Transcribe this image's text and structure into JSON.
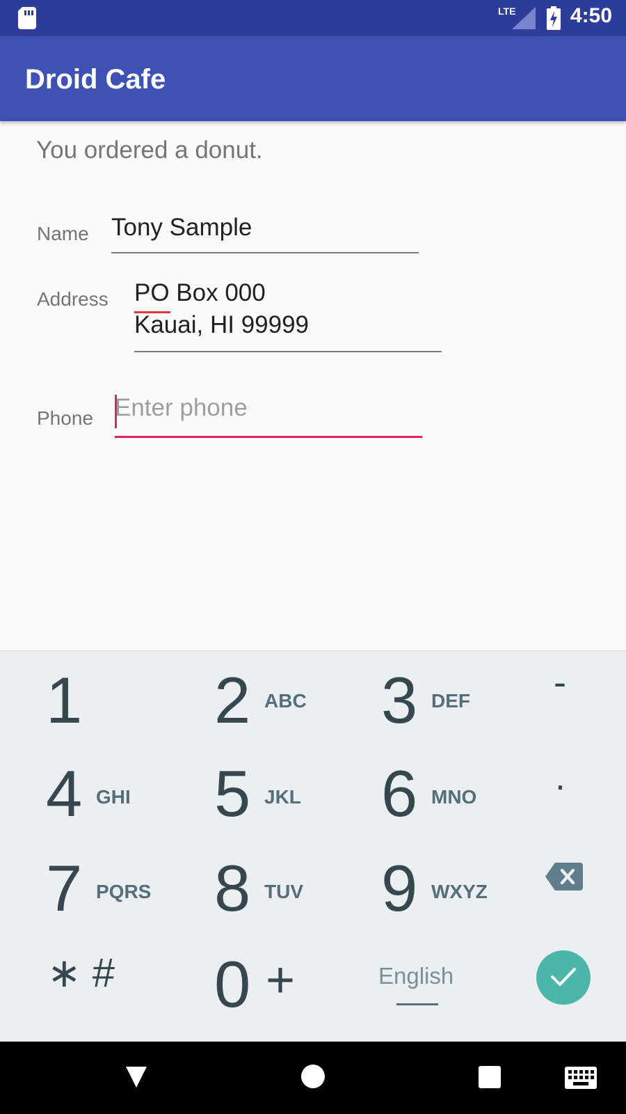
{
  "status_bar": {
    "time": "4:50",
    "network": "LTE",
    "icons": [
      "sd-card-icon",
      "lte-signal-icon",
      "battery-charging-icon"
    ]
  },
  "app_bar": {
    "title": "Droid Cafe"
  },
  "order": {
    "message": "You ordered a donut.",
    "name_label": "Name",
    "name_value": "Tony Sample",
    "address_label": "Address",
    "address_line1": "PO Box 000",
    "address_line2": "Kauai, HI 99999",
    "phone_label": "Phone",
    "phone_placeholder": "Enter phone"
  },
  "keyboard": {
    "keys": [
      {
        "digit": "1",
        "letters": ""
      },
      {
        "digit": "2",
        "letters": "ABC"
      },
      {
        "digit": "3",
        "letters": "DEF"
      },
      {
        "digit": "4",
        "letters": "GHI"
      },
      {
        "digit": "5",
        "letters": "JKL"
      },
      {
        "digit": "6",
        "letters": "MNO"
      },
      {
        "digit": "7",
        "letters": "PQRS"
      },
      {
        "digit": "8",
        "letters": "TUV"
      },
      {
        "digit": "9",
        "letters": "WXYZ"
      },
      {
        "digit": "0",
        "letters": "+"
      }
    ],
    "dash": "-",
    "dot": ".",
    "star_hash": "∗ #",
    "language": "English",
    "accent_color": "#4db6ac"
  },
  "nav_bar": {
    "icons": [
      "back-icon",
      "home-icon",
      "recents-icon",
      "keyboard-icon"
    ]
  },
  "colors": {
    "primary": "#3f51b5",
    "primary_dark": "#2f3d9a",
    "accent": "#e91e63"
  }
}
